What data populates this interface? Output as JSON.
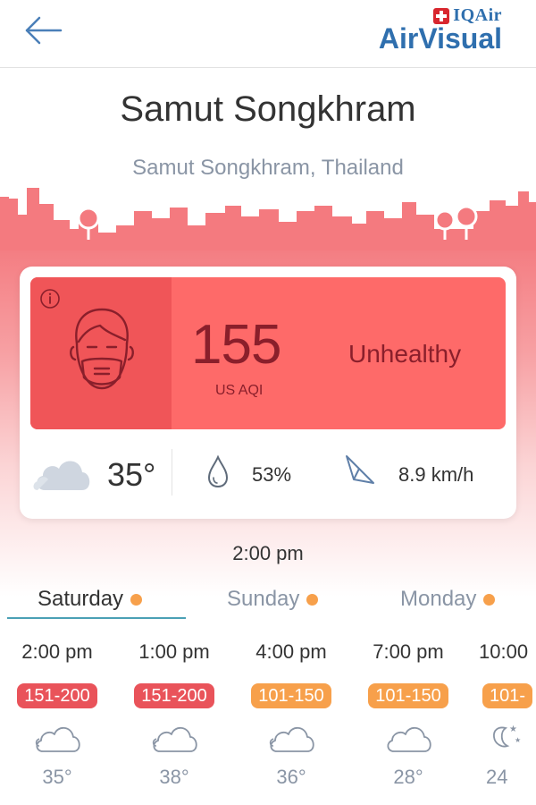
{
  "header": {
    "back_icon": "arrow-left-icon",
    "brand_top": "IQAir",
    "brand_bottom": "AirVisual"
  },
  "location": {
    "city": "Samut Songkhram",
    "region": "Samut Songkhram, Thailand"
  },
  "aqi": {
    "value": "155",
    "unit": "US AQI",
    "status": "Unhealthy",
    "color": "#fe6a69"
  },
  "weather": {
    "temperature": "35°",
    "humidity": "53%",
    "wind": "8.9 km/h"
  },
  "current_time": "2:00 pm",
  "tabs": [
    {
      "label": "Saturday",
      "active": true
    },
    {
      "label": "Sunday",
      "active": false
    },
    {
      "label": "Monday",
      "active": false
    }
  ],
  "hourly": [
    {
      "time": "2:00 pm",
      "aqi": "151-200",
      "color": "#e9535a",
      "icon": "cloud-icon",
      "temp": "35°"
    },
    {
      "time": "1:00 pm",
      "aqi": "151-200",
      "color": "#e9535a",
      "icon": "cloud-icon",
      "temp": "38°"
    },
    {
      "time": "4:00 pm",
      "aqi": "101-150",
      "color": "#f7a04b",
      "icon": "cloud-icon",
      "temp": "36°"
    },
    {
      "time": "7:00 pm",
      "aqi": "101-150",
      "color": "#f7a04b",
      "icon": "cloud-icon",
      "temp": "28°"
    },
    {
      "time": "10:00",
      "aqi": "101-",
      "color": "#f7a04b",
      "icon": "moon-stars-icon",
      "temp": "24"
    }
  ]
}
